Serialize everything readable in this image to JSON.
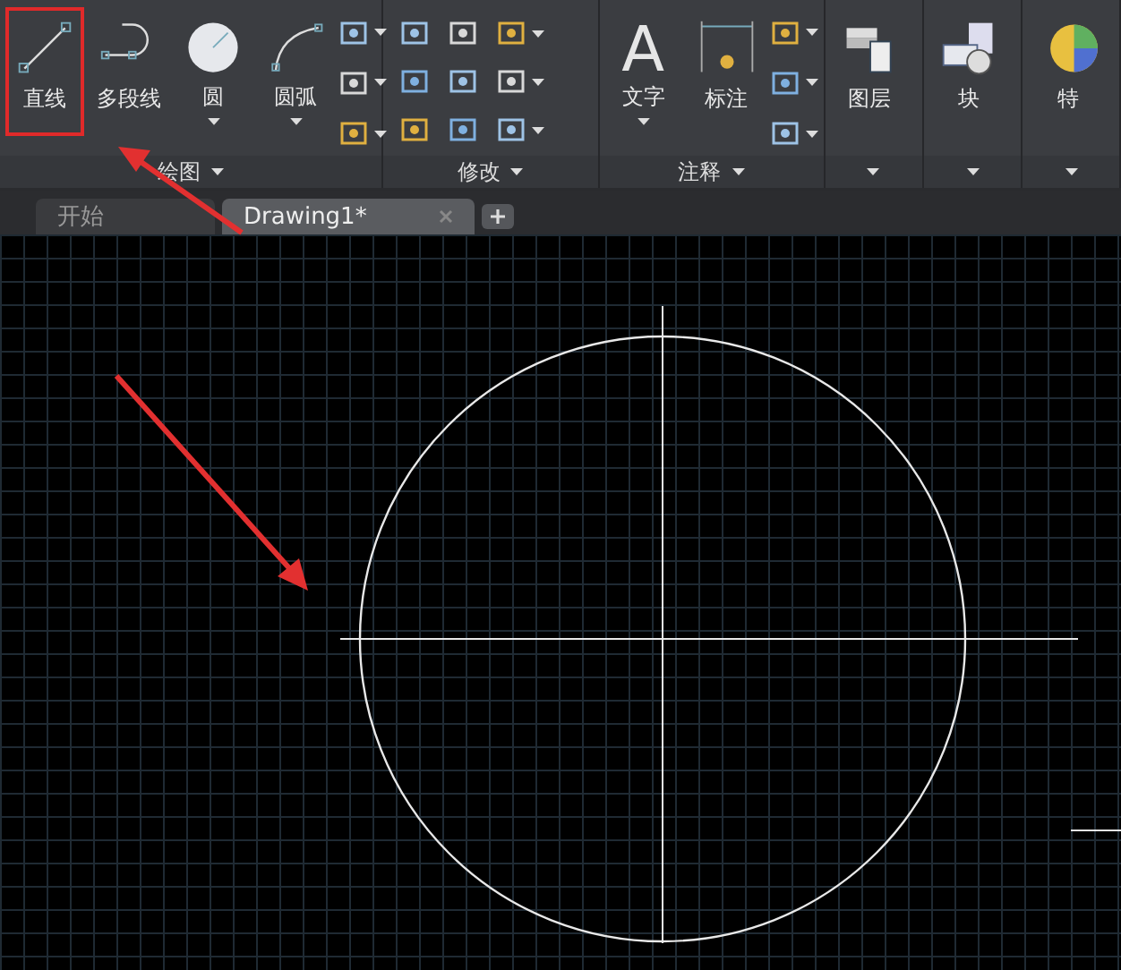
{
  "ribbon": {
    "panels": [
      {
        "title": "绘图",
        "tools": [
          {
            "label": "直线",
            "dropdown": false,
            "highlighted": true
          },
          {
            "label": "多段线",
            "dropdown": false,
            "highlighted": false
          },
          {
            "label": "圆",
            "dropdown": true,
            "highlighted": false
          },
          {
            "label": "圆弧",
            "dropdown": true,
            "highlighted": false
          }
        ]
      },
      {
        "title": "修改"
      },
      {
        "title": "注释",
        "tools": [
          {
            "label": "文字",
            "icon_glyph": "A",
            "dropdown": true,
            "highlighted": false
          },
          {
            "label": "标注",
            "dropdown": false,
            "highlighted": false
          }
        ]
      },
      {
        "tools": [
          {
            "label": "图层",
            "dropdown": false,
            "highlighted": false
          }
        ]
      },
      {
        "tools": [
          {
            "label": "块",
            "dropdown": false,
            "highlighted": false
          }
        ]
      },
      {
        "tools": [
          {
            "label": "特",
            "dropdown": false,
            "highlighted": false
          }
        ]
      }
    ]
  },
  "file_tabs": [
    {
      "label": "开始",
      "selected": false,
      "closable": false
    },
    {
      "label": "Drawing1*",
      "selected": true,
      "closable": true
    }
  ]
}
